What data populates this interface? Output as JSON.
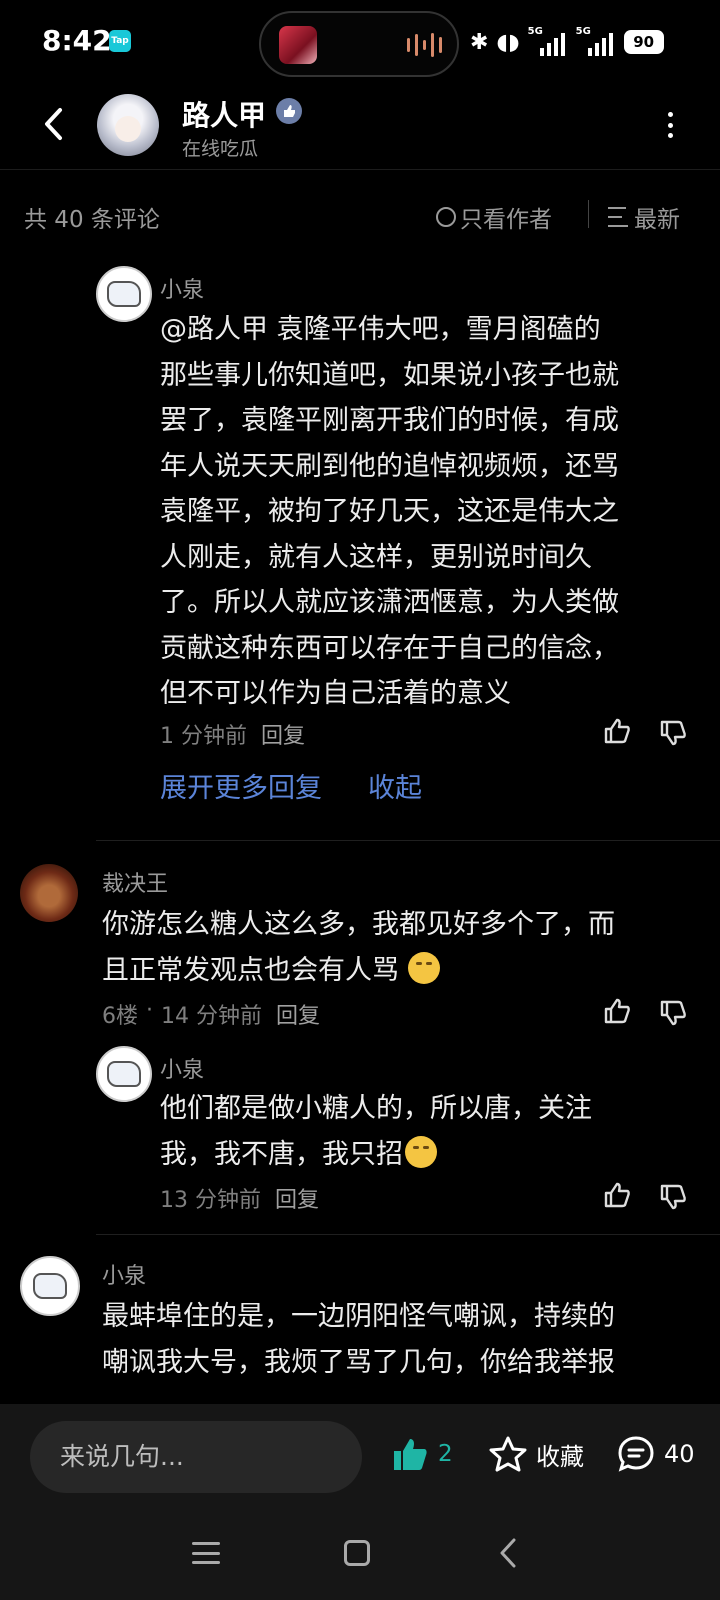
{
  "status_bar": {
    "time": "8:42",
    "app_badge": "Tap",
    "network_1": "5G",
    "network_2": "5G",
    "battery": "90"
  },
  "header": {
    "name": "路人甲",
    "subtitle": "在线吃瓜"
  },
  "filter": {
    "count": "共 40 条评论",
    "author_only": "只看作者",
    "sort": "最新"
  },
  "comments": [
    {
      "author": "小泉",
      "lines": [
        "@路人甲  袁隆平伟大吧，雪月阁磕的",
        "那些事儿你知道吧，如果说小孩子也就",
        "罢了，袁隆平刚离开我们的时候，有成",
        "年人说天天刷到他的追悼视频烦，还骂",
        "袁隆平，被拘了好几天，这还是伟大之",
        "人刚走，就有人这样，更别说时间久",
        "了。所以人就应该潇洒惬意，为人类做",
        "贡献这种东西可以存在于自己的信念，",
        "但不可以作为自己活着的意义"
      ],
      "time": "1 分钟前",
      "reply": "回复"
    },
    {
      "author": "裁决王",
      "lines": [
        "你游怎么糖人这么多，我都见好多个了，而",
        "且正常发观点也会有人骂"
      ],
      "floor": "6楼",
      "time": "14 分钟前",
      "reply": "回复"
    },
    {
      "author": "小泉",
      "lines": [
        "他们都是做小糖人的，所以唐，关注",
        "我，我不唐，我只招"
      ],
      "time": "13 分钟前",
      "reply": "回复"
    },
    {
      "author": "小泉",
      "lines": [
        "最蚌埠住的是，一边阴阳怪气嘲讽，持续的",
        "嘲讽我大号，我烦了骂了几句，你给我举报"
      ]
    }
  ],
  "replies_controls": {
    "expand": "展开更多回复",
    "collapse": "收起"
  },
  "bottom_bar": {
    "input_placeholder": "来说几句...",
    "likes": "2",
    "favorite": "收藏",
    "comments": "40"
  },
  "colors": {
    "accent_teal": "#1fb5a5",
    "link_blue": "#5b84d8",
    "background": "#000000"
  },
  "icons": [
    "back-icon",
    "verify-icon",
    "more-icon",
    "thumb-up-icon",
    "thumb-down-icon",
    "star-icon",
    "comment-bubble-icon",
    "nav-menu-icon",
    "nav-home-icon",
    "nav-back-icon"
  ]
}
